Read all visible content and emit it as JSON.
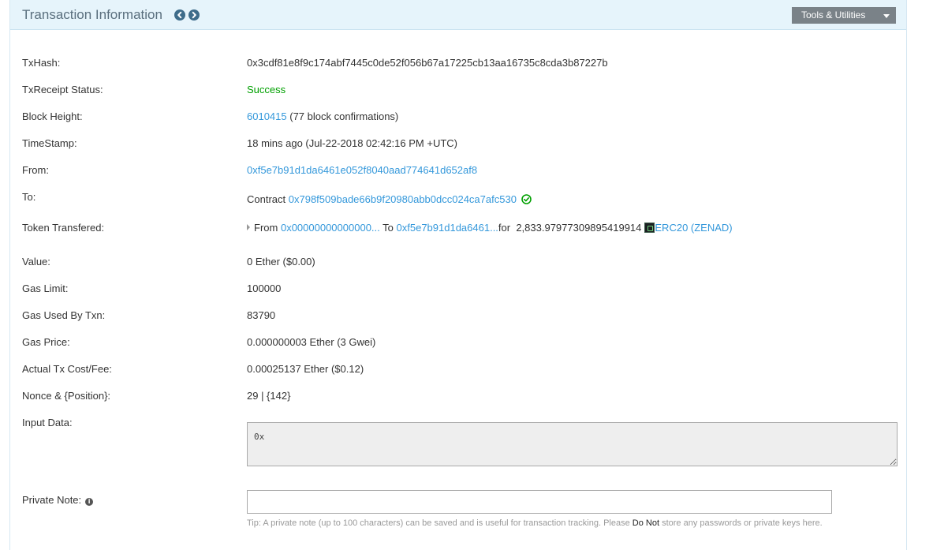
{
  "header": {
    "title": "Transaction Information",
    "tools_label": "Tools & Utilities"
  },
  "labels": {
    "txhash": "TxHash:",
    "status": "TxReceipt Status:",
    "block": "Block Height:",
    "timestamp": "TimeStamp:",
    "from": "From:",
    "to": "To:",
    "token": "Token Transfered:",
    "value": "Value:",
    "gas_limit": "Gas Limit:",
    "gas_used": "Gas Used By Txn:",
    "gas_price": "Gas Price:",
    "fee": "Actual Tx Cost/Fee:",
    "nonce": "Nonce & {Position}:",
    "input": "Input Data:",
    "note": "Private Note:"
  },
  "tx": {
    "hash": "0x3cdf81e8f9c174abf7445c0de52f056b67a17225cb13aa16735c8cda3b87227b",
    "status": "Success",
    "block_number": "6010415",
    "block_confirmations": "(77 block confirmations)",
    "timestamp": "18 mins ago (Jul-22-2018 02:42:16 PM +UTC)",
    "from_address": "0xf5e7b91d1da6461e052f8040aad774641d652af8",
    "to_prefix": "Contract",
    "to_address": "0x798f509bade66b9f20980abb0dcc024ca7afc530",
    "value": "0 Ether ($0.00)",
    "gas_limit": "100000",
    "gas_used": "83790",
    "gas_price": "0.000000003 Ether (3 Gwei)",
    "fee": "0.00025137 Ether ($0.12)",
    "nonce": "29 | {142}",
    "input_data": "0x"
  },
  "token_transfer": {
    "from_word": "From",
    "from_address": "0x00000000000000...",
    "to_word": "To",
    "to_address": "0xf5e7b91d1da6461...",
    "for_word": "for",
    "amount": "2,833.97977309895419914",
    "token_name": "ERC20 (ZENAD)"
  },
  "note": {
    "tip_prefix": "Tip: A private note (up to 100 characters) can be saved and is useful for transaction tracking. Please ",
    "tip_emphasis": "Do Not",
    "tip_suffix": " store any passwords or private keys here."
  },
  "colors": {
    "link": "#3498db",
    "success": "#00a000",
    "header_bg": "#e6f4fb",
    "tools_bg": "#7a8288"
  }
}
